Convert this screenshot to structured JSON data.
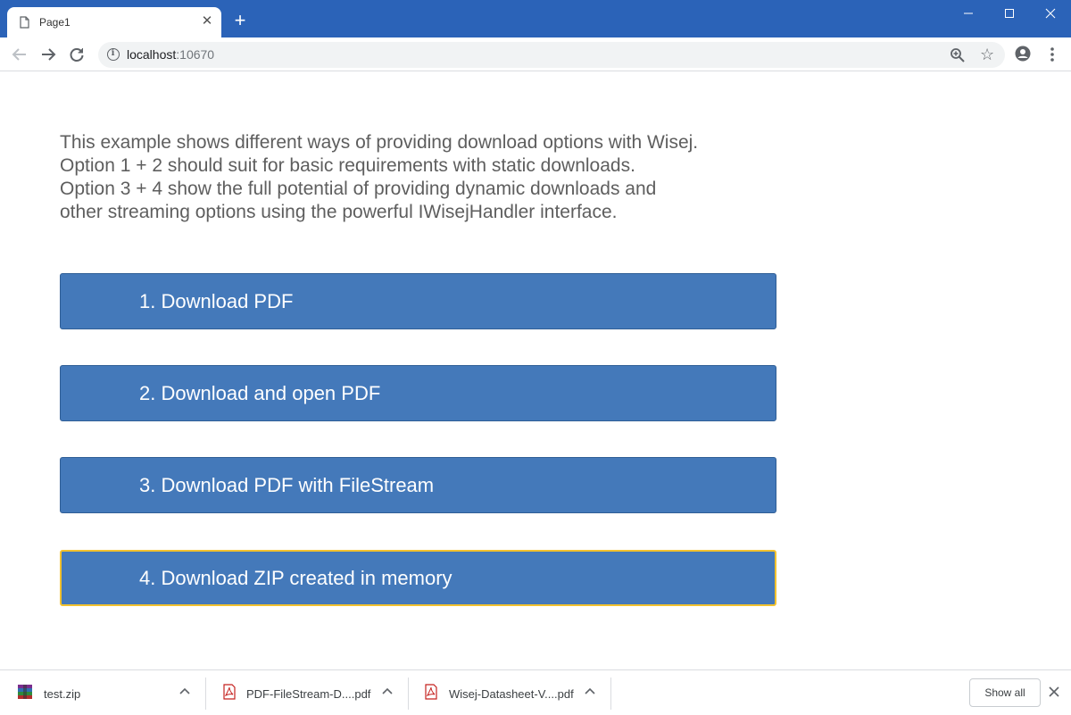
{
  "browser": {
    "tab_title": "Page1",
    "new_tab_label": "+",
    "url_host": "localhost",
    "url_port": ":10670",
    "colors": {
      "titlebar": "#2b63b8",
      "omnibox": "#f1f3f4"
    }
  },
  "page": {
    "intro_lines": [
      "This example shows different ways of providing download options with Wisej.",
      "Option 1 + 2 should suit for basic requirements with static downloads.",
      "Option 3 + 4 show the full potential of providing dynamic downloads and",
      "other streaming options using the powerful IWisejHandler interface."
    ],
    "buttons": [
      {
        "label": "1. Download PDF"
      },
      {
        "label": "2. Download and open PDF"
      },
      {
        "label": "3. Download PDF with FileStream"
      },
      {
        "label": "4. Download ZIP created in memory"
      }
    ],
    "colors": {
      "button": "#4479ba",
      "button_focus_border": "#f2c12e",
      "text": "#5e5e5e"
    }
  },
  "downloads": {
    "items": [
      {
        "name": "test.zip",
        "icon": "archive-icon"
      },
      {
        "name": "PDF-FileStream-D....pdf",
        "icon": "pdf-icon"
      },
      {
        "name": "Wisej-Datasheet-V....pdf",
        "icon": "pdf-icon"
      }
    ],
    "show_all_label": "Show all"
  }
}
